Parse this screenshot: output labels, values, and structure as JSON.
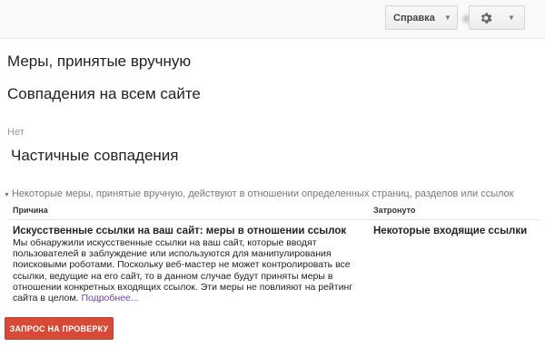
{
  "header": {
    "account_blurred": true,
    "help_label": "Справка",
    "help_caret": "▼",
    "settings_caret": "▼"
  },
  "main": {
    "manual_actions_title": "Меры, принятые вручную",
    "site_wide_title": "Совпадения на всем сайте",
    "site_wide_status": "Нет",
    "partial_title": "Частичные совпадения",
    "partial_note": "Некоторые меры, принятые вручную, действуют в отношении определенных страниц, разделов или ссылок",
    "table": {
      "col_reason": "Причина",
      "col_affected": "Затронуто",
      "rows": [
        {
          "reason_title": "Искусственные ссылки на ваш сайт: меры в отношении ссылок",
          "description": "Мы обнаружили искусственные ссылки на ваш сайт, которые вводят пользователей в заблуждение или используются для манипулирования поисковыми роботами. Поскольку веб-мастер не может контролировать все ссылки, ведущие на его сайт, то в данном случае будут приняты меры в отношении конкретных входящих ссылок. Эти меры не повлияют на рейтинг сайта в целом.",
          "more_link": "Подробнее...",
          "affected": "Некоторые входящие ссылки"
        }
      ]
    },
    "request_review_label": "ЗАПРОС НА ПРОВЕРКУ"
  },
  "colors": {
    "primary_button": "#d84a38",
    "link": "#6d3fb5"
  },
  "icons": [
    "settings-gear-icon",
    "chevron-down-icon",
    "triangle-down-icon"
  ]
}
